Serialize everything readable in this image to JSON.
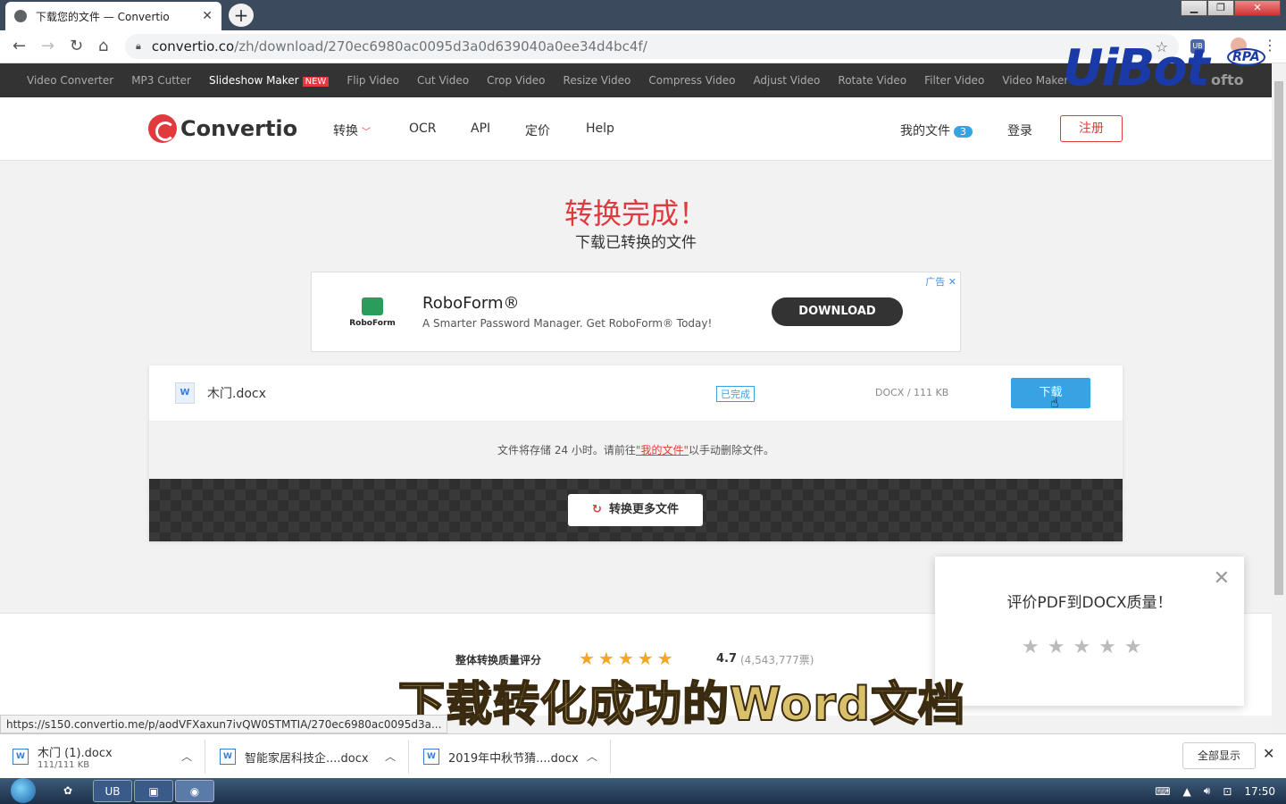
{
  "browser": {
    "tab_title": "下载您的文件 — Convertio",
    "tab_close": "✕",
    "new_tab": "+",
    "url_domain": "convertio.co",
    "url_path": "/zh/download/270ec6980ac0095d3a0d639040a0ee34d4bc4f/",
    "ext_label": "UB",
    "status_url": "https://s150.convertio.me/p/aodVFXaxun7ivQW0STMTIA/270ec6980ac0095d3a..."
  },
  "tools": [
    {
      "label": "Video Converter"
    },
    {
      "label": "MP3 Cutter"
    },
    {
      "label": "Slideshow Maker",
      "badge": "NEW"
    },
    {
      "label": "Flip Video"
    },
    {
      "label": "Cut Video"
    },
    {
      "label": "Crop Video"
    },
    {
      "label": "Resize Video"
    },
    {
      "label": "Compress Video"
    },
    {
      "label": "Adjust Video"
    },
    {
      "label": "Rotate Video"
    },
    {
      "label": "Filter Video"
    },
    {
      "label": "Video Maker"
    }
  ],
  "watermark": {
    "brand": "UiBot",
    "rpa": "RPA",
    "soft": "ofto"
  },
  "header": {
    "logo": "Convertio",
    "nav": {
      "convert": "转换",
      "ocr": "OCR",
      "api": "API",
      "pricing": "定价",
      "help": "Help"
    },
    "my_files": "我的文件",
    "my_files_count": "3",
    "login": "登录",
    "signup": "注册"
  },
  "main": {
    "title": "转换完成！",
    "subtitle": "下载已转换的文件"
  },
  "ad": {
    "logo_text": "RoboForm",
    "title": "RoboForm®",
    "text": "A Smarter Password Manager. Get RoboForm® Today!",
    "button": "DOWNLOAD",
    "choice": "广告 ✕"
  },
  "file": {
    "icon_letter": "W",
    "name": "木门.docx",
    "status": "已完成",
    "size": "DOCX / 111 KB",
    "download": "下载"
  },
  "store_note": {
    "before": "文件将存储 24 小时。请前往",
    "link": "\"我的文件\"",
    "after": "以手动删除文件。"
  },
  "convert_more": "转换更多文件",
  "rating": {
    "label": "整体转换质量评分",
    "stars": "★★★★★",
    "score": "4.7",
    "votes": "(4,543,777票)"
  },
  "popup": {
    "title": "评价PDF到DOCX质量！",
    "stars": "★★★★★",
    "close": "✕"
  },
  "caption": "下载转化成功的Word文档",
  "downloads": [
    {
      "name": "木门 (1).docx",
      "sub": "111/111 KB"
    },
    {
      "name": "智能家居科技企....docx",
      "sub": ""
    },
    {
      "name": "2019年中秋节猜....docx",
      "sub": ""
    }
  ],
  "show_all": "全部显示",
  "taskbar": {
    "clock": "17:50",
    "apps": [
      "UB"
    ]
  }
}
